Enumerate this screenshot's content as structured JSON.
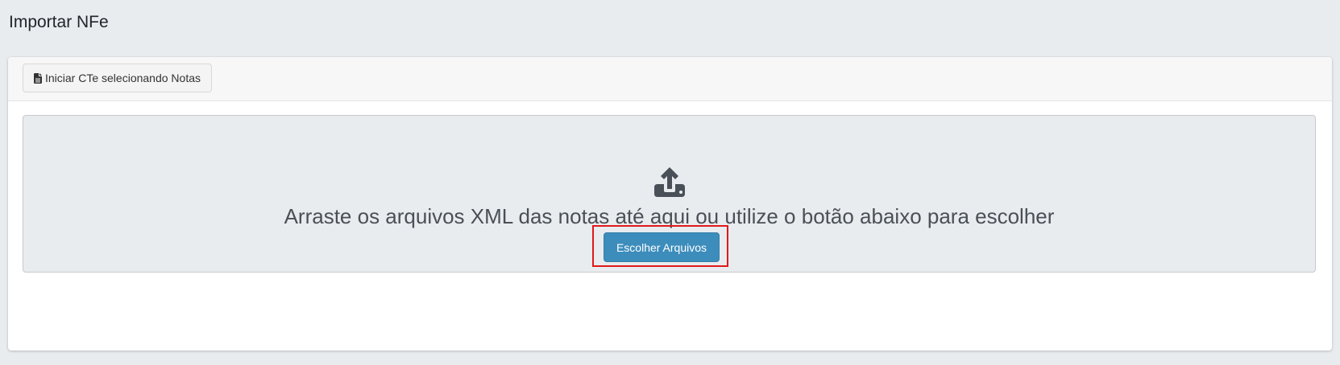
{
  "page": {
    "title": "Importar NFe"
  },
  "toolbar": {
    "start_cte_label": "Iniciar CTe selecionando Notas",
    "start_cte_icon": "file-icon"
  },
  "dropzone": {
    "icon": "upload-icon",
    "message": "Arraste os arquivos XML das notas até aqui ou utilize o botão abaixo para escolher"
  },
  "actions": {
    "choose_files_label": "Escolher Arquivos",
    "highlight_color": "#e0191b",
    "primary_color": "#3c8dbc"
  }
}
